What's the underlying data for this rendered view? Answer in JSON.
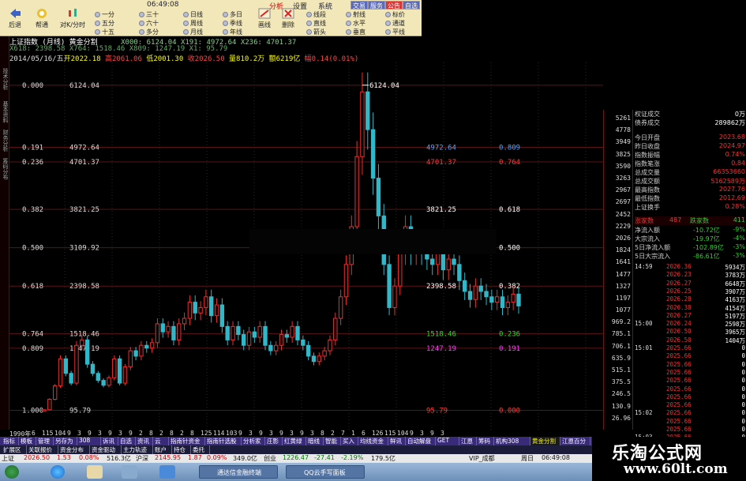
{
  "colors": {
    "up": "#e83030",
    "down": "#30b8c8",
    "grid": "#5a1414",
    "accent_yellow": "#f5f000"
  },
  "toolbar": {
    "clock": "06:49:08",
    "menu_tabs": [
      "分析",
      "设置",
      "系统"
    ],
    "big_buttons": [
      {
        "label": "后退",
        "icon": "back-arrow-icon"
      },
      {
        "label": "帮通",
        "icon": "help-icon"
      },
      {
        "label": "对K/分时",
        "icon": "kline-toggle-icon"
      }
    ],
    "period_items": [
      [
        "一分",
        "三十",
        "日线",
        "多日"
      ],
      [
        "五分",
        "六十",
        "周线",
        "季线"
      ],
      [
        "十五",
        "多分",
        "月线",
        "年线"
      ]
    ],
    "tool_buttons": [
      {
        "label": "画线",
        "icon": "draw-line-icon"
      },
      {
        "label": "删除",
        "icon": "delete-icon"
      }
    ],
    "draw_items": [
      [
        "线段",
        "射线",
        "标价"
      ],
      [
        "直线",
        "水平",
        "通道"
      ],
      [
        "箭头",
        "垂直",
        "平线"
      ]
    ],
    "right_tabs": [
      "交易",
      "服务",
      "公告",
      "自选"
    ]
  },
  "info": {
    "title": "上证指数 (月线) 黄金分割",
    "params": "X000: 6124.04  X191: 4972.64  X236: 4701.37",
    "params2": "X618: 2398.58  X764: 1518.46  X809: 1247.19  X1: 95.79",
    "date": "2014/05/16/五",
    "open": "开2022.18",
    "high": "高2061.06",
    "low": "低2001.30",
    "close": "收2026.50",
    "volume": "量810.2万",
    "amount": "额6219亿",
    "change": "幅0.14(0.01%)"
  },
  "side_tabs": [
    "技术分析",
    "基本资料",
    "财务分析",
    "筹码分布"
  ],
  "chart_data": {
    "type": "candlestick",
    "title": "上证指数 (月线) 黄金分割",
    "ylim": [
      0,
      6400
    ],
    "peak_label": "6124.04",
    "x_ticks": [
      "1990年",
      "6",
      "115",
      "104",
      "9",
      "3",
      "9",
      "3",
      "9",
      "3",
      "9",
      "2",
      "8",
      "2",
      "8",
      "2",
      "8",
      "125",
      "114",
      "103",
      "9",
      "3",
      "9",
      "3",
      "9",
      "3",
      "9",
      "3",
      "8",
      "2",
      "7",
      "1",
      "6",
      "126",
      "115",
      "104",
      "9",
      "3",
      "9",
      "3"
    ],
    "fib_levels": [
      {
        "ratio": "0.000",
        "value": "6124.04",
        "right_value": "",
        "right_ratio": "",
        "color": "#ffffff",
        "price": 6124.04
      },
      {
        "ratio": "0.191",
        "value": "4972.64",
        "right_value": "4972.64",
        "right_ratio": "0.809",
        "color": "#4aa8ff",
        "price": 4972.64
      },
      {
        "ratio": "0.236",
        "value": "4701.37",
        "right_value": "4701.37",
        "right_ratio": "0.764",
        "color": "#ff3a3a",
        "price": 4701.37
      },
      {
        "ratio": "0.382",
        "value": "3821.25",
        "right_value": "3821.25",
        "right_ratio": "0.618",
        "color": "#ffffff",
        "price": 3821.25
      },
      {
        "ratio": "0.500",
        "value": "3109.92",
        "right_value": "",
        "right_ratio": "0.500",
        "color": "#ffffff",
        "price": 3109.92
      },
      {
        "ratio": "0.618",
        "value": "2398.58",
        "right_value": "2398.58",
        "right_ratio": "0.382",
        "color": "#ffffff",
        "price": 2398.58
      },
      {
        "ratio": "0.764",
        "value": "1518.46",
        "right_value": "1518.46",
        "right_ratio": "0.236",
        "color": "#30e030",
        "price": 1518.46
      },
      {
        "ratio": "0.809",
        "value": "1247.19",
        "right_value": "1247.19",
        "right_ratio": "0.191",
        "color": "#ff40ff",
        "price": 1247.19
      },
      {
        "ratio": "1.000",
        "value": "95.79",
        "right_value": "95.79",
        "right_ratio": "0.000",
        "color": "#ff3a3a",
        "price": 95.79
      }
    ],
    "series": [
      {
        "name": "close",
        "values": [
          105,
          300,
          550,
          1050,
          780,
          600,
          1300,
          1400,
          950,
          780,
          650,
          560,
          700,
          1050,
          600,
          900,
          1200,
          1100,
          1300,
          1250,
          1350,
          1700,
          1550,
          1650,
          1400,
          1700,
          1800,
          2100,
          1900,
          2000,
          2200,
          1850,
          2050,
          1650,
          1400,
          1650,
          1500,
          1300,
          1550,
          1450,
          1650,
          1300,
          1200,
          1300,
          1500,
          1450,
          1650,
          1400,
          1300,
          1100,
          1000,
          1100,
          1200,
          1400,
          1800,
          2200,
          2800,
          3500,
          4800,
          6000,
          5300,
          4400,
          3700,
          2800,
          2000,
          2400,
          3000,
          3500,
          3000,
          3200,
          3000,
          2900,
          2800,
          3100,
          2700,
          2900,
          2800,
          2500,
          2300,
          2150,
          2400,
          2300,
          2200,
          2100,
          2200,
          2000,
          2100,
          2250,
          2030
        ]
      }
    ]
  },
  "right_axis": [
    "5261",
    "4778",
    "3949",
    "3825",
    "3590",
    "3263",
    "2967",
    "2697",
    "2452",
    "2229",
    "2026",
    "1824",
    "1641",
    "1477",
    "1327",
    "1197",
    "1077",
    "969.2",
    "785.1",
    "706.1",
    "635.9",
    "515.1",
    "375.5",
    "246.5",
    "130.9",
    "26.96"
  ],
  "right_panel": {
    "top_rows": [
      {
        "k": "权证成交",
        "v": "0万"
      },
      {
        "k": "债券成交",
        "v": "289862万"
      }
    ],
    "stats": [
      {
        "k": "今日开盘",
        "v": "2023.68"
      },
      {
        "k": "昨日收盘",
        "v": "2024.97"
      },
      {
        "k": "指数振幅",
        "v": "0.74%"
      },
      {
        "k": "指数笔涨",
        "v": "0.84"
      },
      {
        "k": "总成交量",
        "v": "66353660"
      },
      {
        "k": "总成交额",
        "v": "5162589万"
      },
      {
        "k": "最高指数",
        "v": "2027.76"
      },
      {
        "k": "最低指数",
        "v": "2012.69"
      },
      {
        "k": "上证换手",
        "v": "0.28%"
      }
    ],
    "updown": {
      "up_label": "涨家数",
      "up": "487",
      "down_label": "跌家数",
      "down": "411"
    },
    "flows": [
      {
        "k": "净流入额",
        "v": "-10.72亿",
        "p": "-9%"
      },
      {
        "k": "大宗流入",
        "v": "-19.97亿",
        "p": "-4%"
      },
      {
        "k": "5日净流入额",
        "v": "-102.89亿",
        "p": "-3%"
      },
      {
        "k": "5日大宗流入",
        "v": "-86.61亿",
        "p": "-3%"
      }
    ],
    "ticks": [
      {
        "t": "14:59",
        "p": "2026.36",
        "v": "5934万"
      },
      {
        "t": "",
        "p": "2026.23",
        "v": "3783万"
      },
      {
        "t": "",
        "p": "2026.27",
        "v": "6648万"
      },
      {
        "t": "",
        "p": "2026.25",
        "v": "3907万"
      },
      {
        "t": "",
        "p": "2026.28",
        "v": "4163万"
      },
      {
        "t": "",
        "p": "2026.38",
        "v": "4154万"
      },
      {
        "t": "",
        "p": "2026.27",
        "v": "5197万"
      },
      {
        "t": "15:00",
        "p": "2026.24",
        "v": "2598万"
      },
      {
        "t": "",
        "p": "2026.50",
        "v": "3965万"
      },
      {
        "t": "",
        "p": "2026.50",
        "v": "1404万"
      },
      {
        "t": "15:01",
        "p": "2025.66",
        "v": "0"
      },
      {
        "t": "",
        "p": "2025.66",
        "v": "0"
      },
      {
        "t": "",
        "p": "2025.66",
        "v": "0"
      },
      {
        "t": "",
        "p": "2025.66",
        "v": "0"
      },
      {
        "t": "",
        "p": "2025.66",
        "v": "0"
      },
      {
        "t": "",
        "p": "2025.66",
        "v": "0"
      },
      {
        "t": "",
        "p": "2025.66",
        "v": "0"
      },
      {
        "t": "",
        "p": "2025.66",
        "v": "0"
      },
      {
        "t": "15:02",
        "p": "2025.66",
        "v": "0"
      },
      {
        "t": "",
        "p": "2025.66",
        "v": "0"
      },
      {
        "t": "",
        "p": "2025.66",
        "v": "0"
      },
      {
        "t": "15:03",
        "p": "2025.66",
        "v": "0"
      }
    ]
  },
  "bottom_tabs": [
    "指标",
    "模板",
    "管理",
    "另存为",
    "308",
    "诉讯",
    "自选",
    "资讯",
    "云",
    "指南针资金",
    "指南针选股",
    "分析家",
    "庄影",
    "红黄绿",
    "暗线",
    "智能",
    "买入",
    "均线资金",
    "鲜讯",
    "自动解盘",
    "GET",
    "江恩",
    "筹码",
    "机构308",
    "黄金分割",
    "江恩百分"
  ],
  "market_tabs": [
    "扩展区",
    "关联报价",
    "资金分布",
    "资金驱动",
    "主力轨迹",
    "账户",
    "持仓",
    "委托"
  ],
  "status": {
    "label": "上证",
    "price": "2026.50",
    "chg": "1.53",
    "pct": "0.08%",
    "amt": "516.3亿",
    "label2": "沪深",
    "price2": "2145.95",
    "chg2": "1.87",
    "pct2": "0.09%",
    "amt2": "349.0亿",
    "label3": "创业",
    "price3": "1226.47",
    "chg3": "-27.41",
    "pct3": "-2.19%",
    "amt3": "179.5亿",
    "vip": "VIP_成都",
    "day": "周日",
    "time": "06:49:08"
  },
  "taskbar": {
    "task1": "通达信金融终端",
    "task2": "QQ云手写面板"
  },
  "watermark": {
    "line1": "乐淘公式网",
    "line2": "www.60lt.com"
  }
}
